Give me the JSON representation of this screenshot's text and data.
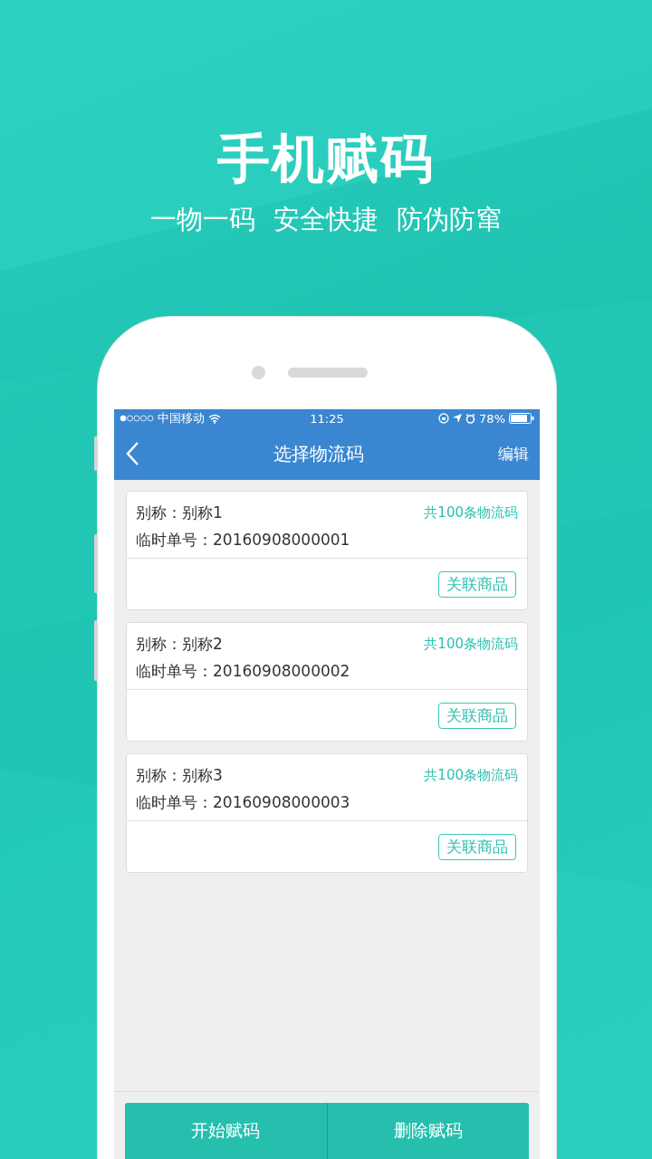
{
  "headline": "手机赋码",
  "slogans": [
    "一物一码",
    "安全快捷",
    "防伪防窜"
  ],
  "status_bar": {
    "carrier": "中国移动",
    "time": "11:25",
    "battery": "78%"
  },
  "nav_bar": {
    "title": "选择物流码",
    "action": "编辑"
  },
  "cards": [
    {
      "alias": "别称：别称1",
      "count": "共100条物流码",
      "order": "临时单号：20160908000001",
      "button": "关联商品"
    },
    {
      "alias": "别称：别称2",
      "count": "共100条物流码",
      "order": "临时单号：20160908000002",
      "button": "关联商品"
    },
    {
      "alias": "别称：别称3",
      "count": "共100条物流码",
      "order": "临时单号：20160908000003",
      "button": "关联商品"
    }
  ],
  "bottom_buttons": [
    "开始赋码",
    "删除赋码"
  ]
}
